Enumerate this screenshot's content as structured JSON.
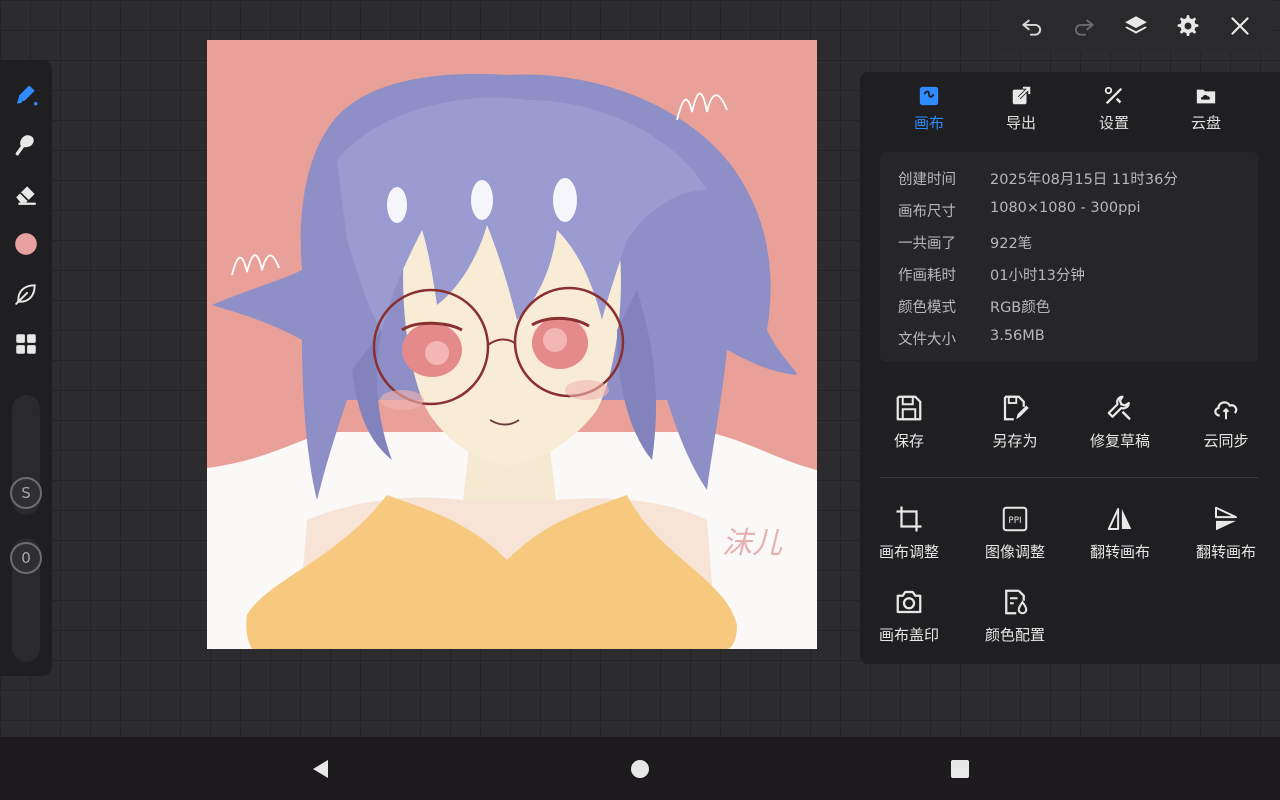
{
  "topbar": {
    "undo_icon": "undo-icon",
    "redo_icon": "redo-icon",
    "layers_icon": "layers-icon",
    "settings_icon": "gear-icon",
    "close_icon": "close-icon"
  },
  "toolbar": {
    "tools": [
      "pen-icon",
      "smudge-icon",
      "eraser-icon",
      "color-swatch",
      "leaf-icon",
      "grid-icon"
    ],
    "current_color": "#e8a0a0",
    "size_slider_label": "S",
    "opacity_slider_label": "0"
  },
  "panel": {
    "tabs": [
      {
        "label": "画布",
        "icon": "canvas-icon",
        "active": true
      },
      {
        "label": "导出",
        "icon": "export-icon",
        "active": false
      },
      {
        "label": "设置",
        "icon": "tools-icon",
        "active": false
      },
      {
        "label": "云盘",
        "icon": "cloud-drive-icon",
        "active": false
      }
    ],
    "info": [
      {
        "key": "创建时间",
        "value": "2025年08月15日 11时36分"
      },
      {
        "key": "画布尺寸",
        "value": "1080×1080 - 300ppi"
      },
      {
        "key": "一共画了",
        "value": "922笔"
      },
      {
        "key": "作画耗时",
        "value": "01小时13分钟"
      },
      {
        "key": "颜色模式",
        "value": "RGB颜色"
      },
      {
        "key": "文件大小",
        "value": "3.56MB"
      }
    ],
    "actions_row1": [
      {
        "label": "保存",
        "icon": "save-icon"
      },
      {
        "label": "另存为",
        "icon": "save-as-icon"
      },
      {
        "label": "修复草稿",
        "icon": "repair-icon"
      },
      {
        "label": "云同步",
        "icon": "cloud-sync-icon"
      }
    ],
    "actions_row2": [
      {
        "label": "画布调整",
        "icon": "crop-icon"
      },
      {
        "label": "图像调整",
        "icon": "ppi-icon"
      },
      {
        "label": "翻转画布",
        "icon": "flip-horizontal-icon"
      },
      {
        "label": "翻转画布",
        "icon": "flip-vertical-icon"
      }
    ],
    "actions_row3": [
      {
        "label": "画布盖印",
        "icon": "camera-icon"
      },
      {
        "label": "颜色配置",
        "icon": "color-config-icon"
      }
    ]
  },
  "canvas": {
    "signature_text": "沫儿"
  },
  "colors": {
    "accent": "#2f8bff",
    "canvas_bg": "#e8a098"
  },
  "navbar": {
    "back_icon": "back-icon",
    "home_icon": "home-icon",
    "recents_icon": "recents-icon"
  }
}
